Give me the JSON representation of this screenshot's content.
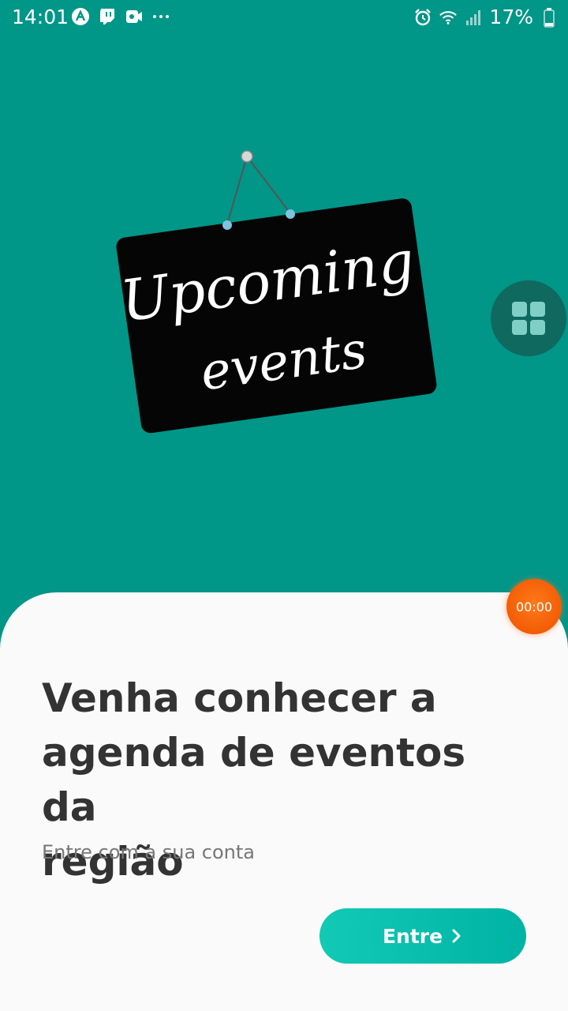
{
  "status_bar": {
    "time": "14:01",
    "battery": "17%",
    "left_icons": [
      "app-icon",
      "twitch-icon",
      "video-icon",
      "more-dots-icon"
    ],
    "right_icons": [
      "alarm-icon",
      "wifi-icon",
      "signal-icon",
      "battery-icon"
    ]
  },
  "illustration": {
    "sign_line1": "Upcoming",
    "sign_line2": "events"
  },
  "floating_button": {
    "icon": "grid-icon"
  },
  "timer": {
    "value": "00:00"
  },
  "card": {
    "headline_line1": "Venha conhecer a",
    "headline_line2": "agenda de eventos da",
    "headline_line3": "região",
    "subtitle": "Entre com a sua conta",
    "button_label": "Entre",
    "button_icon": "chevron-right-icon"
  },
  "colors": {
    "background": "#009688",
    "card": "#fafafa",
    "button": "#00b3a4",
    "timer": "#f25c05",
    "headline": "#333333",
    "subtitle": "#777777"
  }
}
